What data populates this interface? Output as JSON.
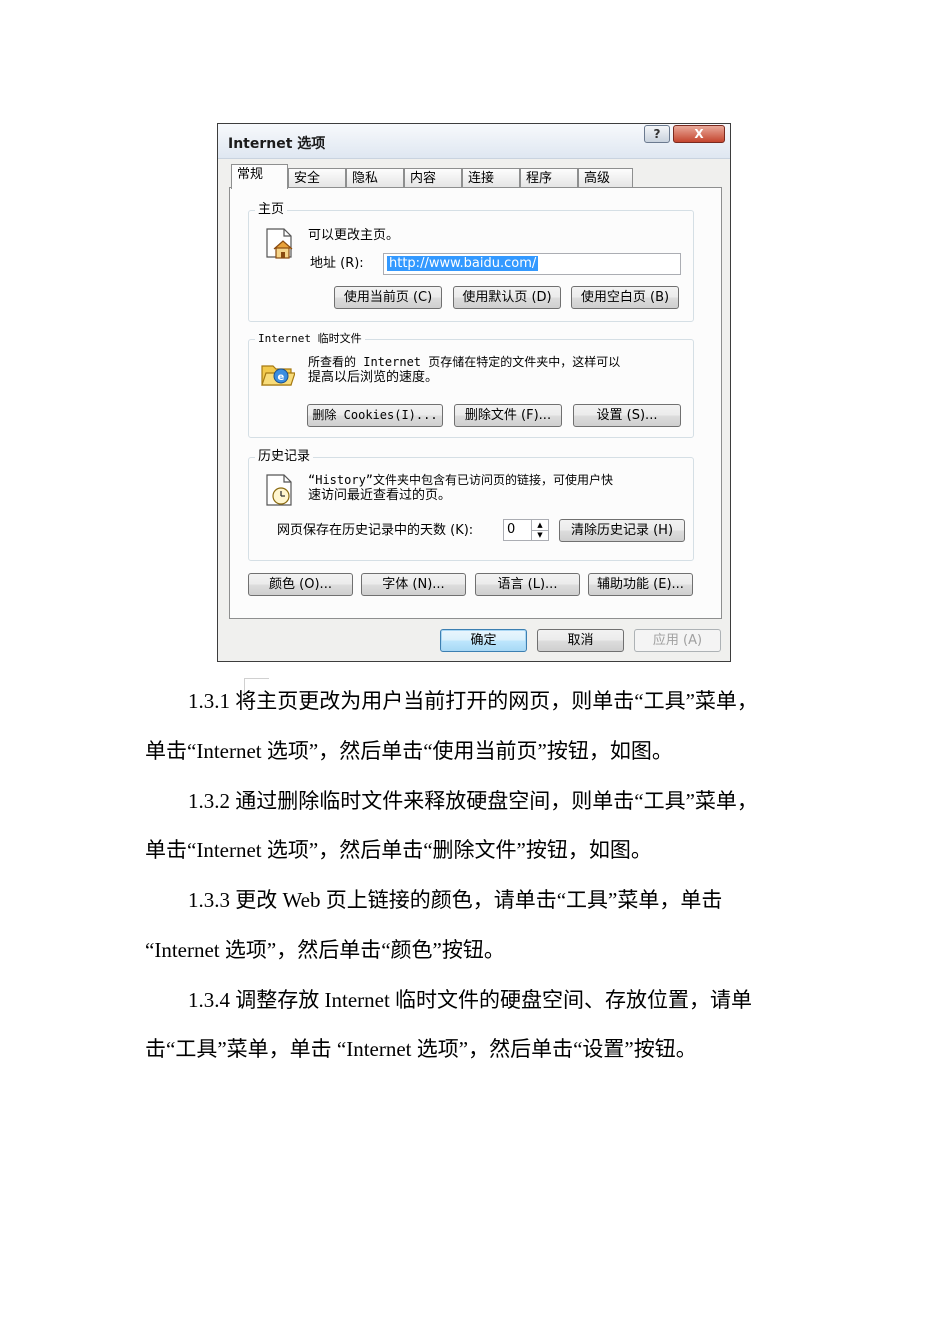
{
  "dialog": {
    "title": "Internet 选项",
    "help_symbol": "?",
    "close_symbol": "X",
    "tabs": [
      "常规",
      "安全",
      "隐私",
      "内容",
      "连接",
      "程序",
      "高级"
    ],
    "homepage": {
      "group_label": "主页",
      "description": "可以更改主页。",
      "address_label": "地址 (R):",
      "address_value": "http://www.baidu.com/",
      "btn_current": "使用当前页 (C)",
      "btn_default": "使用默认页 (D)",
      "btn_blank": "使用空白页 (B)"
    },
    "temp_files": {
      "group_label": "Internet 临时文件",
      "description_line1": "所查看的 Internet 页存储在特定的文件夹中，这样可以",
      "description_line2": "提高以后浏览的速度。",
      "btn_delete_cookies": "删除 Cookies(I)...",
      "btn_delete_files": "删除文件 (F)...",
      "btn_settings": "设置 (S)..."
    },
    "history": {
      "group_label": "历史记录",
      "description_line1": "“History”文件夹中包含有已访问页的链接，可使用户快",
      "description_line2": "速访问最近查看过的页。",
      "days_label": "网页保存在历史记录中的天数 (K):",
      "days_value": "0",
      "btn_clear": "清除历史记录 (H)"
    },
    "bottom_buttons": {
      "colors": "颜色 (O)...",
      "fonts": "字体 (N)...",
      "languages": "语言 (L)...",
      "accessibility": "辅助功能 (E)..."
    },
    "footer": {
      "ok": "确定",
      "cancel": "取消",
      "apply": "应用 (A)"
    }
  },
  "document": {
    "p1_line1": "1.3.1 将主页更改为用户当前打开的网页，则单击“工具”菜单，",
    "p1_line2": "单击“Internet 选项”，然后单击“使用当前页”按钮，如图。",
    "p2_line1": "1.3.2 通过删除临时文件来释放硬盘空间，则单击“工具”菜单，",
    "p2_line2": "单击“Internet 选项”，然后单击“删除文件”按钮，如图。",
    "p3_line1": "1.3.3 更改  Web 页上链接的颜色，请单击“工具”菜单，单击",
    "p3_line2": "“Internet 选项”，然后单击“颜色”按钮。",
    "p4_line1": "1.3.4 调整存放  Internet 临时文件的硬盘空间、存放位置，请单",
    "p4_line2": "击“工具”菜单，单击  “Internet 选项”，然后单击“设置”按钮。"
  }
}
